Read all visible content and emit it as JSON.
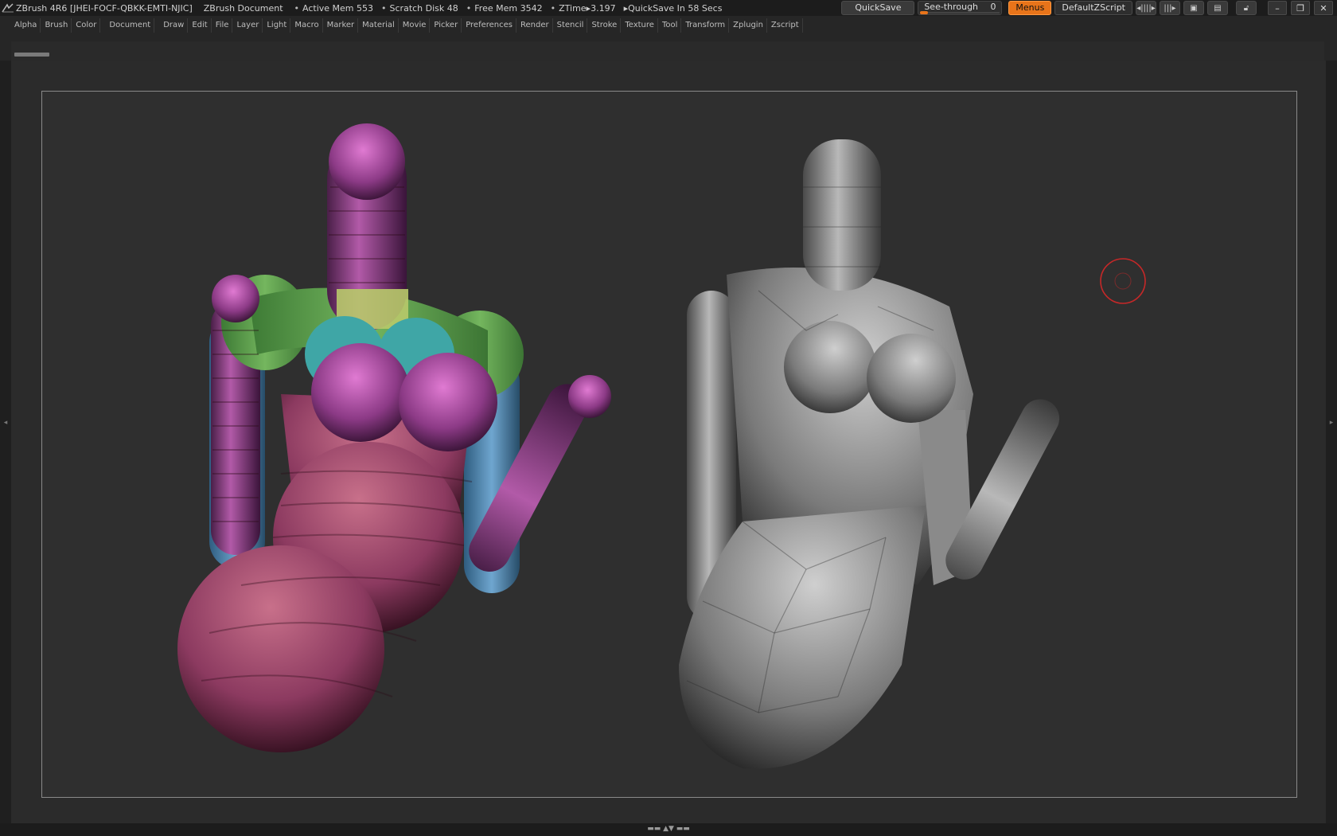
{
  "title": {
    "app": "ZBrush 4R6 [JHEI-FOCF-QBKK-EMTI-NJIC]",
    "document": "ZBrush Document",
    "stats": [
      {
        "label": "Active Mem 553"
      },
      {
        "label": "Scratch Disk 48"
      },
      {
        "label": "Free Mem 3542"
      },
      {
        "label": "ZTime▸3.197"
      },
      {
        "label": "▸QuickSave In 58 Secs"
      }
    ]
  },
  "toolbar": {
    "quicksave_label": "QuickSave",
    "seethrough_label": "See-through",
    "seethrough_value": "0",
    "seethrough_level": 0,
    "menus_label": "Menus",
    "script_label": "DefaultZScript"
  },
  "menu": {
    "items": [
      "Alpha",
      "Brush",
      "Color",
      "Document",
      "Draw",
      "Edit",
      "File",
      "Layer",
      "Light",
      "Macro",
      "Marker",
      "Material",
      "Movie",
      "Picker",
      "Preferences",
      "Render",
      "Stencil",
      "Stroke",
      "Texture",
      "Tool",
      "Transform",
      "Zplugin",
      "Zscript"
    ]
  },
  "icons": {
    "logo": "zbrush-logo-icon",
    "cursor": "brush-cursor-icon"
  },
  "colors": {
    "accent": "#e8741a",
    "cursor": "#c62828"
  }
}
